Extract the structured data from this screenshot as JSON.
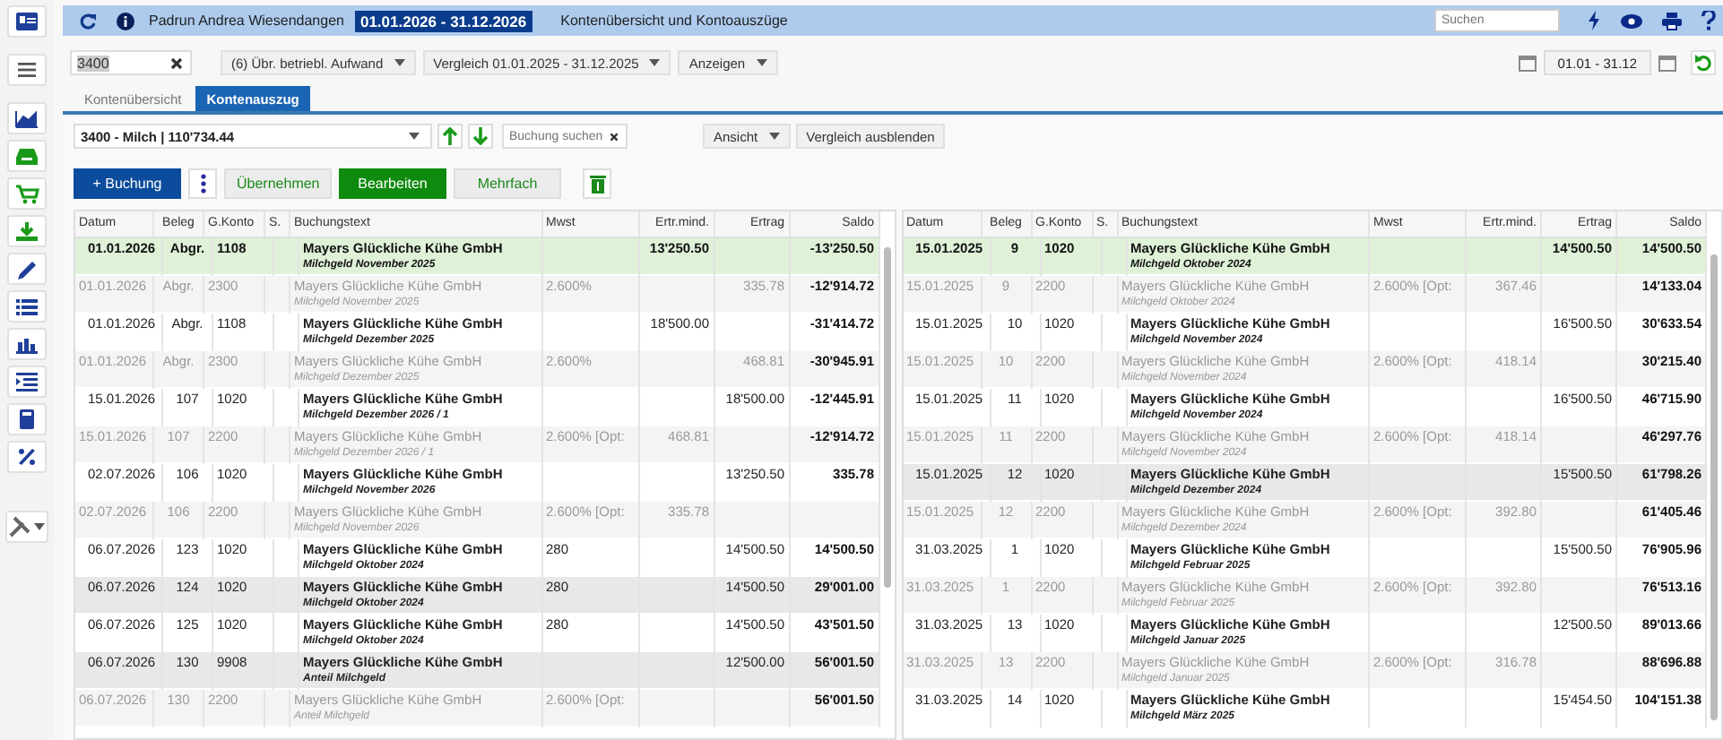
{
  "header": {
    "user": "Padrun Andrea Wiesendangen",
    "period": "01.01.2026 - 31.12.2026",
    "title": "Kontenübersicht und Kontoauszüge",
    "search": {
      "placeholder": "Suchen"
    }
  },
  "toolbar": {
    "account_filter": {
      "value": "3400"
    },
    "dropdowns": [
      "(6) Übr. betriebl. Aufwand",
      "Vergleich 01.01.2025 - 31.12.2025",
      "Anzeigen"
    ],
    "date_range": {
      "value": "01.01 - 31.12"
    }
  },
  "tabs": [
    {
      "label": "Kontenübersicht",
      "selected": false
    },
    {
      "label": "Kontenauszug",
      "selected": true
    }
  ],
  "account_select": {
    "value": "3400 - Milch | 110'734.44"
  },
  "booking_search": {
    "placeholder": "Buchung suchen"
  },
  "view_buttons": [
    {
      "label": "Ansicht",
      "kind": "dropdown"
    },
    {
      "label": "Vergleich ausblenden",
      "kind": "button"
    }
  ],
  "actions": [
    {
      "label": "+ Buchung",
      "kind": "primary"
    },
    {
      "kind": "more"
    },
    {
      "label": "Übernehmen",
      "kind": "secondary"
    },
    {
      "label": "Bearbeiten",
      "kind": "success"
    },
    {
      "label": "Mehrfach",
      "kind": "secondary"
    },
    {
      "kind": "delete"
    }
  ],
  "tables": [
    {
      "columns": [
        "Datum",
        "Beleg",
        "G.Konto",
        "S.",
        "Buchungstext",
        "Mwst",
        "Ertr.mind.",
        "Ertrag",
        "Saldo"
      ],
      "rows": [
        {
          "kind": "main",
          "selected": true,
          "highlighted": false,
          "date": "01.01.2026",
          "voucher": "Abgr.",
          "account": "1108",
          "text": "Mayers Glückliche Kühe GmbH",
          "memo": "Milchgeld November 2025",
          "min_revenue": "13'250.50",
          "balance": "-13'250.50"
        },
        {
          "kind": "tax",
          "selected": false,
          "highlighted": false,
          "date": "01.01.2026",
          "voucher": "Abgr.",
          "account": "2300",
          "text": "Mayers Glückliche Kühe GmbH",
          "memo": "Milchgeld November 2025",
          "vat": "2.600%",
          "revenue": "335.78",
          "balance": "-12'914.72"
        },
        {
          "kind": "main",
          "selected": false,
          "highlighted": false,
          "date": "01.01.2026",
          "voucher": "Abgr.",
          "account": "1108",
          "text": "Mayers Glückliche Kühe GmbH",
          "memo": "Milchgeld Dezember 2025",
          "min_revenue": "18'500.00",
          "balance": "-31'414.72"
        },
        {
          "kind": "tax",
          "selected": false,
          "highlighted": false,
          "date": "01.01.2026",
          "voucher": "Abgr.",
          "account": "2300",
          "text": "Mayers Glückliche Kühe GmbH",
          "memo": "Milchgeld Dezember 2025",
          "vat": "2.600%",
          "revenue": "468.81",
          "balance": "-30'945.91"
        },
        {
          "kind": "main",
          "selected": false,
          "highlighted": false,
          "date": "15.01.2026",
          "voucher": "107",
          "account": "1020",
          "text": "Mayers Glückliche Kühe GmbH",
          "memo": "Milchgeld Dezember 2026 / 1",
          "revenue": "18'500.00",
          "balance": "-12'445.91"
        },
        {
          "kind": "tax",
          "selected": false,
          "highlighted": false,
          "date": "15.01.2026",
          "voucher": "107",
          "account": "2200",
          "text": "Mayers Glückliche Kühe GmbH",
          "memo": "Milchgeld Dezember 2026 / 1",
          "vat": "2.600% [Opt:",
          "min_revenue": "468.81",
          "balance": "-12'914.72"
        },
        {
          "kind": "main",
          "selected": false,
          "highlighted": false,
          "date": "02.07.2026",
          "voucher": "106",
          "account": "1020",
          "text": "Mayers Glückliche Kühe GmbH",
          "memo": "Milchgeld November 2026",
          "revenue": "13'250.50",
          "balance": "335.78"
        },
        {
          "kind": "tax",
          "selected": false,
          "highlighted": false,
          "date": "02.07.2026",
          "voucher": "106",
          "account": "2200",
          "text": "Mayers Glückliche Kühe GmbH",
          "memo": "Milchgeld November 2026",
          "vat": "2.600% [Opt:",
          "min_revenue": "335.78"
        },
        {
          "kind": "main",
          "selected": false,
          "highlighted": false,
          "date": "06.07.2026",
          "voucher": "123",
          "account": "1020",
          "text": "Mayers Glückliche Kühe GmbH",
          "memo": "Milchgeld Oktober 2024",
          "vat": "280",
          "revenue": "14'500.50",
          "balance": "14'500.50"
        },
        {
          "kind": "main",
          "selected": false,
          "highlighted": true,
          "date": "06.07.2026",
          "voucher": "124",
          "account": "1020",
          "text": "Mayers Glückliche Kühe GmbH",
          "memo": "Milchgeld Oktober 2024",
          "vat": "280",
          "revenue": "14'500.50",
          "balance": "29'001.00"
        },
        {
          "kind": "main",
          "selected": false,
          "highlighted": false,
          "date": "06.07.2026",
          "voucher": "125",
          "account": "1020",
          "text": "Mayers Glückliche Kühe GmbH",
          "memo": "Milchgeld Oktober 2024",
          "vat": "280",
          "revenue": "14'500.50",
          "balance": "43'501.50"
        },
        {
          "kind": "main",
          "selected": false,
          "highlighted": true,
          "date": "06.07.2026",
          "voucher": "130",
          "account": "9908",
          "text": "Mayers Glückliche Kühe GmbH",
          "memo": "Anteil Milchgeld",
          "revenue": "12'500.00",
          "balance": "56'001.50"
        },
        {
          "kind": "tax",
          "selected": false,
          "highlighted": false,
          "date": "06.07.2026",
          "voucher": "130",
          "account": "2200",
          "text": "Mayers Glückliche Kühe GmbH",
          "memo": "Anteil Milchgeld",
          "vat": "2.600% [Opt:",
          "balance": "56'001.50"
        }
      ]
    },
    {
      "columns": [
        "Datum",
        "Beleg",
        "G.Konto",
        "S.",
        "Buchungstext",
        "Mwst",
        "Ertr.mind.",
        "Ertrag",
        "Saldo"
      ],
      "rows": [
        {
          "kind": "main",
          "selected": true,
          "highlighted": false,
          "date": "15.01.2025",
          "voucher": "9",
          "account": "1020",
          "text": "Mayers Glückliche Kühe GmbH",
          "memo": "Milchgeld Oktober 2024",
          "revenue": "14'500.50",
          "balance": "14'500.50"
        },
        {
          "kind": "tax",
          "selected": false,
          "highlighted": false,
          "date": "15.01.2025",
          "voucher": "9",
          "account": "2200",
          "text": "Mayers Glückliche Kühe GmbH",
          "memo": "Milchgeld Oktober 2024",
          "vat": "2.600% [Opt:",
          "min_revenue": "367.46",
          "balance": "14'133.04"
        },
        {
          "kind": "main",
          "selected": false,
          "highlighted": false,
          "date": "15.01.2025",
          "voucher": "10",
          "account": "1020",
          "text": "Mayers Glückliche Kühe GmbH",
          "memo": "Milchgeld November 2024",
          "revenue": "16'500.50",
          "balance": "30'633.54"
        },
        {
          "kind": "tax",
          "selected": false,
          "highlighted": false,
          "date": "15.01.2025",
          "voucher": "10",
          "account": "2200",
          "text": "Mayers Glückliche Kühe GmbH",
          "memo": "Milchgeld November 2024",
          "vat": "2.600% [Opt:",
          "min_revenue": "418.14",
          "balance": "30'215.40"
        },
        {
          "kind": "main",
          "selected": false,
          "highlighted": false,
          "date": "15.01.2025",
          "voucher": "11",
          "account": "1020",
          "text": "Mayers Glückliche Kühe GmbH",
          "memo": "Milchgeld November 2024",
          "revenue": "16'500.50",
          "balance": "46'715.90"
        },
        {
          "kind": "tax",
          "selected": false,
          "highlighted": false,
          "date": "15.01.2025",
          "voucher": "11",
          "account": "2200",
          "text": "Mayers Glückliche Kühe GmbH",
          "memo": "Milchgeld November 2024",
          "vat": "2.600% [Opt:",
          "min_revenue": "418.14",
          "balance": "46'297.76"
        },
        {
          "kind": "main",
          "selected": false,
          "highlighted": true,
          "date": "15.01.2025",
          "voucher": "12",
          "account": "1020",
          "text": "Mayers Glückliche Kühe GmbH",
          "memo": "Milchgeld Dezember 2024",
          "revenue": "15'500.50",
          "balance": "61'798.26"
        },
        {
          "kind": "tax",
          "selected": false,
          "highlighted": false,
          "date": "15.01.2025",
          "voucher": "12",
          "account": "2200",
          "text": "Mayers Glückliche Kühe GmbH",
          "memo": "Milchgeld Dezember 2024",
          "vat": "2.600% [Opt:",
          "min_revenue": "392.80",
          "balance": "61'405.46"
        },
        {
          "kind": "main",
          "selected": false,
          "highlighted": false,
          "date": "31.03.2025",
          "voucher": "1",
          "account": "1020",
          "text": "Mayers Glückliche Kühe GmbH",
          "memo": "Milchgeld Februar 2025",
          "revenue": "15'500.50",
          "balance": "76'905.96"
        },
        {
          "kind": "tax",
          "selected": false,
          "highlighted": false,
          "date": "31.03.2025",
          "voucher": "1",
          "account": "2200",
          "text": "Mayers Glückliche Kühe GmbH",
          "memo": "Milchgeld Februar 2025",
          "vat": "2.600% [Opt:",
          "min_revenue": "392.80",
          "balance": "76'513.16"
        },
        {
          "kind": "main",
          "selected": false,
          "highlighted": false,
          "date": "31.03.2025",
          "voucher": "13",
          "account": "1020",
          "text": "Mayers Glückliche Kühe GmbH",
          "memo": "Milchgeld Januar 2025",
          "revenue": "12'500.50",
          "balance": "89'013.66"
        },
        {
          "kind": "tax",
          "selected": false,
          "highlighted": false,
          "date": "31.03.2025",
          "voucher": "13",
          "account": "2200",
          "text": "Mayers Glückliche Kühe GmbH",
          "memo": "Milchgeld Januar 2025",
          "vat": "2.600% [Opt:",
          "min_revenue": "316.78",
          "balance": "88'696.88"
        },
        {
          "kind": "main",
          "selected": false,
          "highlighted": false,
          "date": "31.03.2025",
          "voucher": "14",
          "account": "1020",
          "text": "Mayers Glückliche Kühe GmbH",
          "memo": "Milchgeld März 2025",
          "revenue": "15'454.50",
          "balance": "104'151.38"
        }
      ]
    }
  ]
}
